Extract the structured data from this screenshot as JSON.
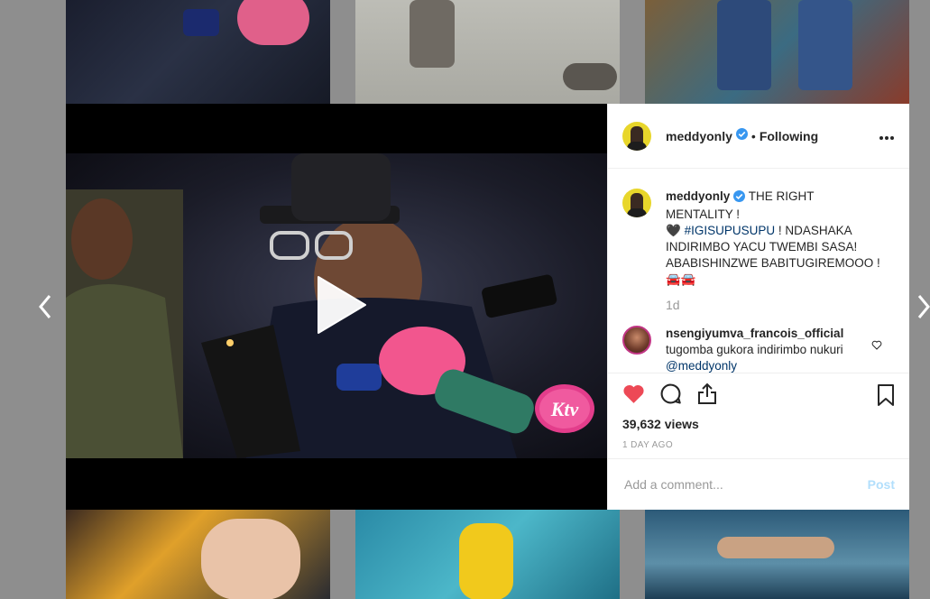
{
  "post": {
    "username": "meddyonly",
    "separator": "•",
    "follow_status": "Following",
    "more_label": "•••"
  },
  "caption": {
    "username": "meddyonly",
    "text_1": " THE RIGHT MENTALITY ! ",
    "heart": "🖤",
    "hashtag": "#IGISUPUSUPU",
    "text_2": " ! NDASHAKA INDIRIMBO YACU TWEMBI SASA! ABABISHINZWE BABITUGIREMOOO !",
    "emojis": "🚘🚘",
    "time": "1d"
  },
  "reply": {
    "username": "nsengiyumva_francois_official",
    "text": "tugomba gukora indirimbo nukuri ",
    "mention": "@meddyonly"
  },
  "stats": {
    "views": "39,632 views",
    "date": "1 DAY AGO"
  },
  "composer": {
    "placeholder": "Add a comment...",
    "post_label": "Post"
  },
  "video": {
    "watermark": "Ktv"
  },
  "nav": {
    "prev": "‹",
    "next": "›"
  },
  "colors": {
    "like_red": "#ed4956",
    "verified_blue": "#3897f0",
    "link_blue": "#003569",
    "post_disabled": "#b2dffc"
  }
}
